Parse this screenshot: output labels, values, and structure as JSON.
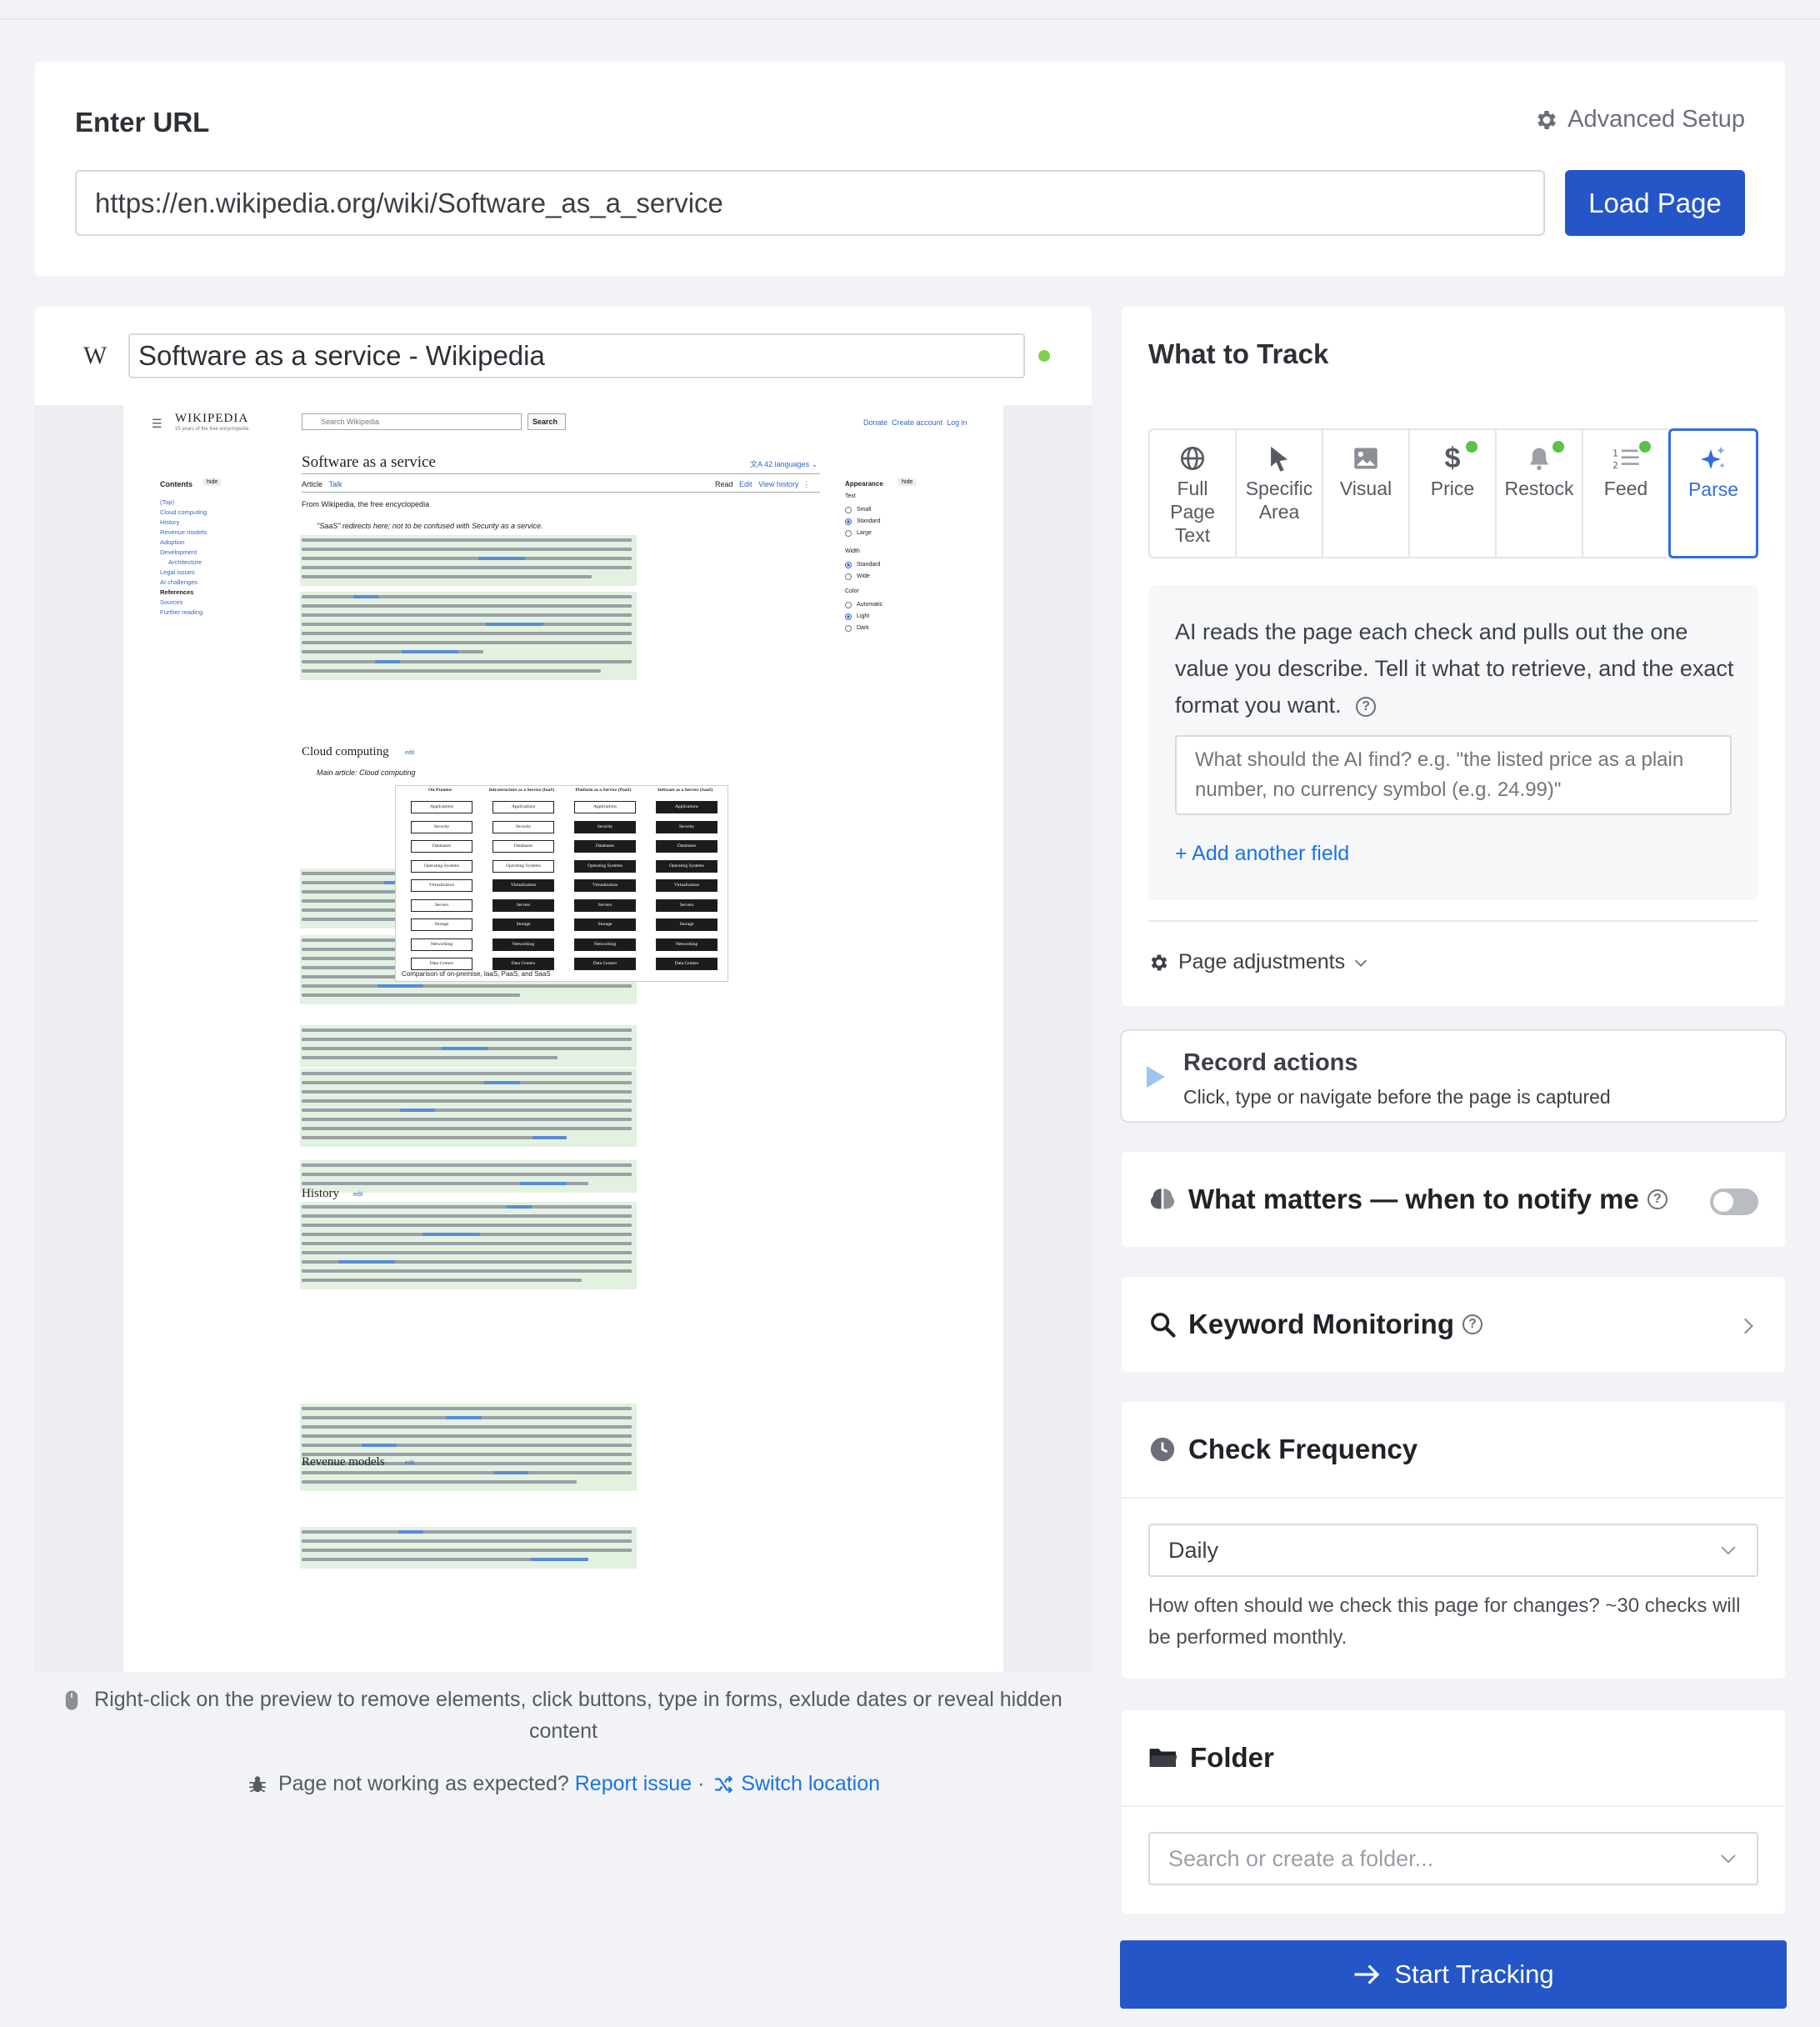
{
  "url_card": {
    "title": "Enter URL",
    "advanced_setup": "Advanced Setup",
    "url_value": "https://en.wikipedia.org/wiki/Software_as_a_service",
    "load_button": "Load Page"
  },
  "preview": {
    "site_logo": "W",
    "page_title": "Software as a service - Wikipedia",
    "status_color": "#7fd14c",
    "hint": "Right-click on the preview to remove elements, click buttons, type in forms, exlude dates or reveal hidden content",
    "issue_prefix": "Page not working as expected?",
    "report_issue": "Report issue",
    "separator": "·",
    "switch_location": "Switch location"
  },
  "wiki": {
    "logo": "WIKIPEDIA",
    "tagline": "25 years of the free encyclopedia",
    "search_placeholder": "Search Wikipedia",
    "search_button": "Search",
    "top_links": [
      "Donate",
      "Create account",
      "Log in"
    ],
    "article_title": "Software as a service",
    "languages": "42 languages",
    "tabs_left": [
      "Article",
      "Talk"
    ],
    "tabs_right": [
      "Read",
      "Edit",
      "View history"
    ],
    "from_line": "From Wikipedia, the free encyclopedia",
    "hatnote": "\"SaaS\" redirects here; not to be confused with Security as a service.",
    "contents_title": "Contents",
    "hide": "hide",
    "contents": [
      "(Top)",
      "Cloud computing",
      "History",
      "Revenue models",
      "Adoption",
      "Development",
      "Architecture",
      "Legal issues",
      "AI challenges",
      "References",
      "Sources",
      "Further reading"
    ],
    "appearance_title": "Appearance",
    "appearance": {
      "text_label": "Text",
      "text_options": [
        "Small",
        "Standard",
        "Large"
      ],
      "width_label": "Width",
      "width_options": [
        "Standard",
        "Wide"
      ],
      "color_label": "Color",
      "color_options": [
        "Automatic",
        "Light",
        "Dark"
      ]
    },
    "headings": [
      "Cloud computing",
      "History",
      "Revenue models"
    ],
    "edit": "edit",
    "main_article": "Main article: Cloud computing",
    "diagram_caption": "Comparison of on-premise, IaaS, PaaS, and SaaS",
    "diagram_columns": [
      "On-Premise",
      "Infrastructure as a Service (IaaS)",
      "Platform as a Service (PaaS)",
      "Software as a Service (SaaS)"
    ],
    "diagram_rows": [
      "Applications",
      "Security",
      "Databases",
      "Operating Systems",
      "Virtualization",
      "Servers",
      "Storage",
      "Networking",
      "Data Centers"
    ]
  },
  "track": {
    "title": "What to Track",
    "tabs": [
      {
        "label": "Full Page Text",
        "icon": "globe-icon",
        "dot": false
      },
      {
        "label": "Specific Area",
        "icon": "cursor-icon",
        "dot": false
      },
      {
        "label": "Visual",
        "icon": "image-icon",
        "dot": false
      },
      {
        "label": "Price",
        "icon": "dollar-icon",
        "dot": true
      },
      {
        "label": "Restock",
        "icon": "bell-icon",
        "dot": true
      },
      {
        "label": "Feed",
        "icon": "list-icon",
        "dot": true
      },
      {
        "label": "Parse",
        "icon": "sparkle-icon",
        "dot": false
      }
    ],
    "ai_description": "AI reads the page each check and pulls out the one value you describe. Tell it what to retrieve, and the exact format you want.",
    "ai_placeholder": "What should the AI find? e.g. \"the listed price as a plain number, no currency symbol (e.g. 24.99)\"",
    "add_field": "+ Add another field",
    "page_adjustments": "Page adjustments"
  },
  "record": {
    "title": "Record actions",
    "subtitle": "Click, type or navigate before the page is captured"
  },
  "notify": {
    "title": "What matters — when to notify me",
    "enabled": false
  },
  "keyword": {
    "title": "Keyword Monitoring"
  },
  "frequency": {
    "title": "Check Frequency",
    "value": "Daily",
    "help": "How often should we check this page for changes? ~30 checks will be performed monthly."
  },
  "folder": {
    "title": "Folder",
    "placeholder": "Search or create a folder..."
  },
  "start_button": "Start Tracking",
  "colors": {
    "primary": "#2456c8",
    "link": "#1a73e8",
    "active_tab": "#2f6fe0",
    "dot_green": "#5cc148"
  }
}
